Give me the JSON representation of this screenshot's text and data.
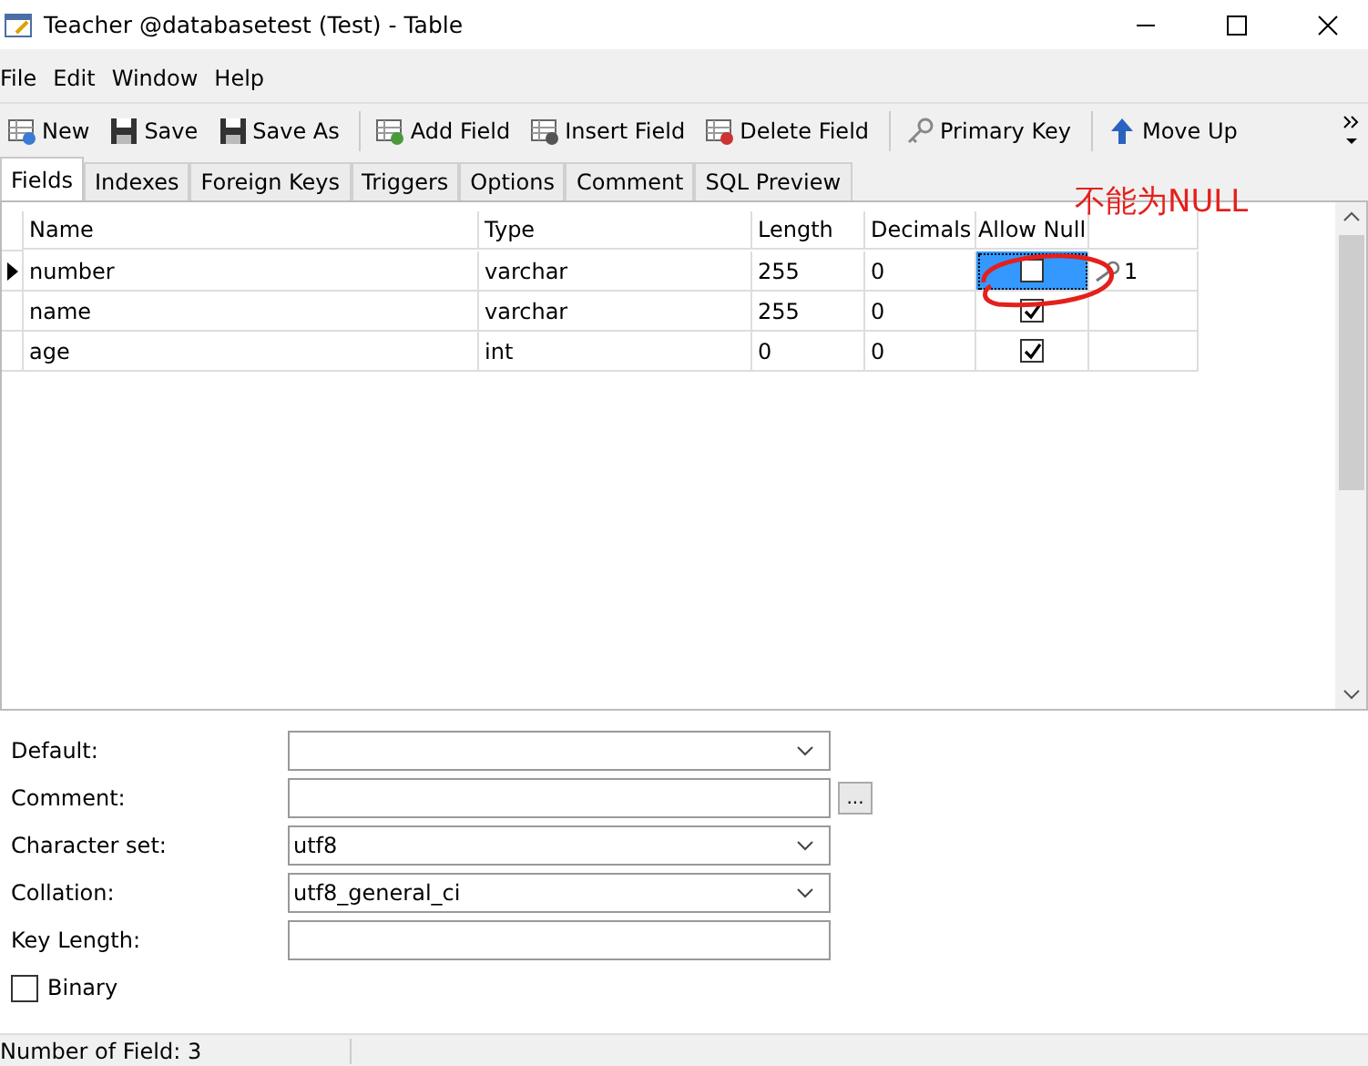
{
  "window": {
    "title": "Teacher @databasetest (Test) - Table"
  },
  "menu": [
    "File",
    "Edit",
    "Window",
    "Help"
  ],
  "toolbar": [
    {
      "label": "New",
      "kind": "new"
    },
    {
      "label": "Save",
      "kind": "save"
    },
    {
      "label": "Save As",
      "kind": "saveas"
    },
    {
      "label": "Add Field",
      "kind": "add"
    },
    {
      "label": "Insert Field",
      "kind": "insert"
    },
    {
      "label": "Delete Field",
      "kind": "delete"
    },
    {
      "label": "Primary Key",
      "kind": "key"
    },
    {
      "label": "Move Up",
      "kind": "up"
    }
  ],
  "tabs": [
    {
      "label": "Fields",
      "selected": true
    },
    {
      "label": "Indexes",
      "selected": false
    },
    {
      "label": "Foreign Keys",
      "selected": false
    },
    {
      "label": "Triggers",
      "selected": false
    },
    {
      "label": "Options",
      "selected": false
    },
    {
      "label": "Comment",
      "selected": false
    },
    {
      "label": "SQL Preview",
      "selected": false
    }
  ],
  "table": {
    "columns": [
      "Name",
      "Type",
      "Length",
      "Decimals",
      "Allow Null"
    ],
    "rows": [
      {
        "name": "number",
        "type": "varchar",
        "length": "255",
        "decimals": "0",
        "allow_null": false,
        "selected": true,
        "key": "1"
      },
      {
        "name": "name",
        "type": "varchar",
        "length": "255",
        "decimals": "0",
        "allow_null": true,
        "selected": false
      },
      {
        "name": "age",
        "type": "int",
        "length": "0",
        "decimals": "0",
        "allow_null": true,
        "selected": false
      }
    ]
  },
  "annotation": {
    "text": "不能为NULL"
  },
  "properties": [
    {
      "label": "Default:",
      "kind": "dropdown"
    },
    {
      "label": "Comment:",
      "kind": "text_button",
      "button": "..."
    },
    {
      "label": "Character set:",
      "kind": "dropdown",
      "value": "utf8"
    },
    {
      "label": "Collation:",
      "kind": "dropdown",
      "value": "utf8_general_ci"
    },
    {
      "label": "Key Length:",
      "kind": "text"
    }
  ],
  "binary": {
    "label": "Binary",
    "checked": false
  },
  "status_bar": "Number of Field: 3"
}
